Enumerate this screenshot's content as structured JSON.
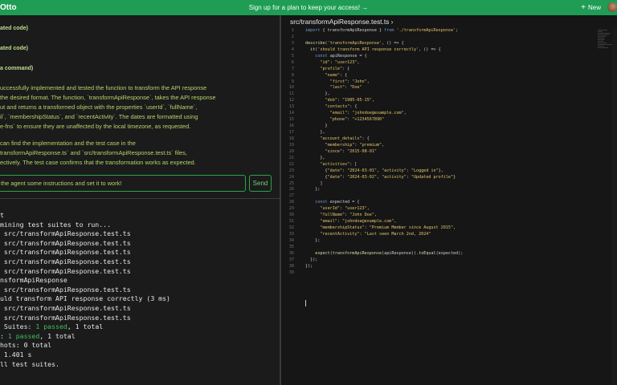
{
  "topbar": {
    "brand": "Otto",
    "banner": "Sign up for a plan to keep your access! →",
    "new_label": "New",
    "accent": "#1f9d55"
  },
  "chat": {
    "line1": "ated code)",
    "line2": "ated code)",
    "line3": "a command)",
    "para1": [
      "uccessfully implemented and tested the function to transform the API response",
      "the desired format. The function, `transformApiResponse`, takes the API response",
      "ut and returns a transformed object with the properties `userId`, `fullName`,",
      "il`, `membershipStatus`, and `recentActivity`. The dates are formatted using",
      "e-fns` to ensure they are unaffected by the local timezone, as requested."
    ],
    "para2": [
      "can find the implementation and the test case in the",
      "transformApiResponse.ts` and `src/transformApiResponse.test.ts` files,",
      "ectively. The test case confirms that the transformation works as expected."
    ],
    "input_value": "the agent some instructions and set it to work!",
    "send_label": "Send"
  },
  "terminal": [
    "t",
    "mining test suites to run...",
    " src/transformApiResponse.test.ts",
    " src/transformApiResponse.test.ts",
    " src/transformApiResponse.test.ts",
    " src/transformApiResponse.test.ts",
    " src/transformApiResponse.test.ts",
    "nsformApiResponse",
    " src/transformApiResponse.test.ts",
    "uld transform API response correctly (3 ms)",
    " src/transformApiResponse.test.ts",
    " src/transformApiResponse.test.ts"
  ],
  "terminal_summary": {
    "suites_prefix": " Suites: ",
    "suites_pass": "1 passed",
    "suites_total": ", 1 total",
    "tests_prefix": ": ",
    "tests_pass": "1 passed",
    "tests_total": ", 1 total",
    "snapshots": "hots: 0 total",
    "time": " 1.401 s",
    "done": "ll test suites."
  },
  "editor": {
    "tab": "src/transformApiResponse.test.ts ›",
    "line_numbers": [
      "1",
      "2",
      "3",
      "4",
      "5",
      "6",
      "7",
      "8",
      "9",
      "10",
      "11",
      "12",
      "13",
      "14",
      "15",
      "16",
      "17",
      "18",
      "19",
      "20",
      "21",
      "22",
      "23",
      "24",
      "25",
      "26",
      "27",
      "28",
      "29",
      "30",
      "31",
      "32",
      "33",
      "34",
      "35",
      "36",
      "37",
      "38",
      "39"
    ]
  }
}
